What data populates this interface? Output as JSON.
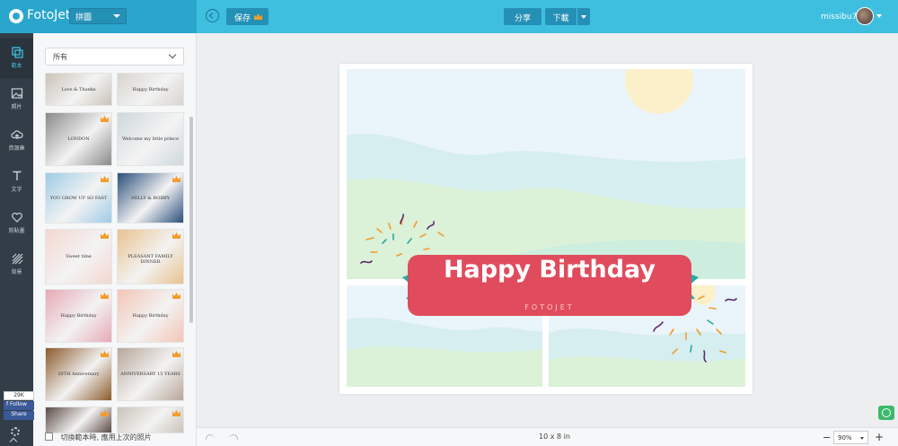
{
  "app": {
    "name": "FotoJet",
    "mode": "拼圖"
  },
  "toolbar": {
    "save_label": "保存",
    "share_label": "分享",
    "download_label": "下載",
    "username": "missibu73"
  },
  "rail": [
    {
      "label": "範本",
      "icon": "template-icon",
      "active": true
    },
    {
      "label": "照片",
      "icon": "photo-icon",
      "active": false
    },
    {
      "label": "資源庫",
      "icon": "cloud-library-icon",
      "active": false
    },
    {
      "label": "文字",
      "icon": "text-icon",
      "active": false
    },
    {
      "label": "剪貼畫",
      "icon": "clipart-heart-icon",
      "active": false
    },
    {
      "label": "背景",
      "icon": "background-icon",
      "active": false
    }
  ],
  "panel": {
    "category": "所有",
    "templates": [
      {
        "caption": "Love & Thanks",
        "premium": false,
        "bg": "#c9c3b8"
      },
      {
        "caption": "Happy Birthday",
        "premium": false,
        "bg": "#d8d4cf"
      },
      {
        "caption": "LONDON",
        "premium": true,
        "bg": "#8a8a8a"
      },
      {
        "caption": "Welcome my little prince",
        "premium": false,
        "bg": "#cfd8dc"
      },
      {
        "caption": "YOU GROW UP SO FAST",
        "premium": true,
        "bg": "#9fcbe6"
      },
      {
        "caption": "MILLY & BOBBY",
        "premium": true,
        "bg": "#2b4f7c"
      },
      {
        "caption": "Sweet time",
        "premium": true,
        "bg": "#f4d7d0"
      },
      {
        "caption": "PLEASANT FAMILY DINNER",
        "premium": true,
        "bg": "#e8c28e"
      },
      {
        "caption": "Happy Birthday",
        "premium": true,
        "bg": "#e7a9b6"
      },
      {
        "caption": "Happy Birthday",
        "premium": true,
        "bg": "#f3c5b5"
      },
      {
        "caption": "20TH Anniversary",
        "premium": true,
        "bg": "#8b5a2b"
      },
      {
        "caption": "ANNIVERSARY 15 YEARS",
        "premium": true,
        "bg": "#b8a79a"
      },
      {
        "caption": "",
        "premium": true,
        "bg": "#5c4a44"
      },
      {
        "caption": "",
        "premium": true,
        "bg": "#c9c3b8"
      }
    ],
    "bottom_option": "切換範本時, 應用上次的照片"
  },
  "social": {
    "count": "29K",
    "follow": "Follow",
    "share": "Share"
  },
  "canvas": {
    "title": "Happy Birthday",
    "subtitle": "FOTOJET",
    "ribbon_color": "#e04c5d",
    "accent_colors": {
      "teal": "#2aa7a3",
      "orange": "#f39c2c",
      "purple": "#5a2a6b"
    }
  },
  "bottombar": {
    "size": "10 x 8 in",
    "zoom": "90%",
    "minus": "−",
    "plus": "+"
  }
}
